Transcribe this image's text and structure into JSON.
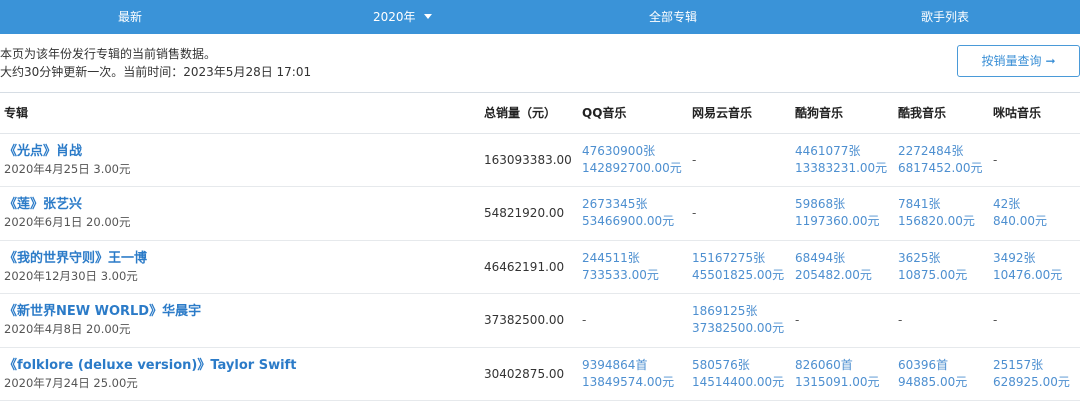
{
  "nav": {
    "latest": "最新",
    "year": "2020年",
    "all_albums": "全部专辑",
    "singer_list": "歌手列表"
  },
  "info": {
    "line1": "本页为该年份发行专辑的当前销售数据。",
    "line2": "大约30分钟更新一次。当前时间：2023年5月28日 17:01"
  },
  "query_button": {
    "label": "按销量查询",
    "arrow": "➞"
  },
  "table": {
    "headers": [
      "专辑",
      "总销量（元）",
      "QQ音乐",
      "网易云音乐",
      "酷狗音乐",
      "酷我音乐",
      "咪咕音乐"
    ],
    "rows": [
      {
        "title": "《光点》肖战",
        "sub": "2020年4月25日  3.00元",
        "total": "163093383.00",
        "qq": [
          "47630900张",
          "142892700.00元"
        ],
        "netease": [
          "-",
          ""
        ],
        "kugou": [
          "4461077张",
          "13383231.00元"
        ],
        "kuwo": [
          "2272484张",
          "6817452.00元"
        ],
        "migu": [
          "-",
          ""
        ]
      },
      {
        "title": "《莲》张艺兴",
        "sub": "2020年6月1日  20.00元",
        "total": "54821920.00",
        "qq": [
          "2673345张",
          "53466900.00元"
        ],
        "netease": [
          "-",
          ""
        ],
        "kugou": [
          "59868张",
          "1197360.00元"
        ],
        "kuwo": [
          "7841张",
          "156820.00元"
        ],
        "migu": [
          "42张",
          "840.00元"
        ]
      },
      {
        "title": "《我的世界守则》王一博",
        "sub": "2020年12月30日  3.00元",
        "total": "46462191.00",
        "qq": [
          "244511张",
          "733533.00元"
        ],
        "netease": [
          "15167275张",
          "45501825.00元"
        ],
        "kugou": [
          "68494张",
          "205482.00元"
        ],
        "kuwo": [
          "3625张",
          "10875.00元"
        ],
        "migu": [
          "3492张",
          "10476.00元"
        ]
      },
      {
        "title": "《新世界NEW WORLD》华晨宇",
        "sub": "2020年4月8日  20.00元",
        "total": "37382500.00",
        "qq": [
          "-",
          ""
        ],
        "netease": [
          "1869125张",
          "37382500.00元"
        ],
        "kugou": [
          "-",
          ""
        ],
        "kuwo": [
          "-",
          ""
        ],
        "migu": [
          "-",
          ""
        ]
      },
      {
        "title": "《folklore (deluxe version)》Taylor Swift",
        "sub": "2020年7月24日  25.00元",
        "total": "30402875.00",
        "qq": [
          "9394864首",
          "13849574.00元"
        ],
        "netease": [
          "580576张",
          "14514400.00元"
        ],
        "kugou": [
          "826060首",
          "1315091.00元"
        ],
        "kuwo": [
          "60396首",
          "94885.00元"
        ],
        "migu": [
          "25157张",
          "628925.00元"
        ]
      }
    ]
  }
}
